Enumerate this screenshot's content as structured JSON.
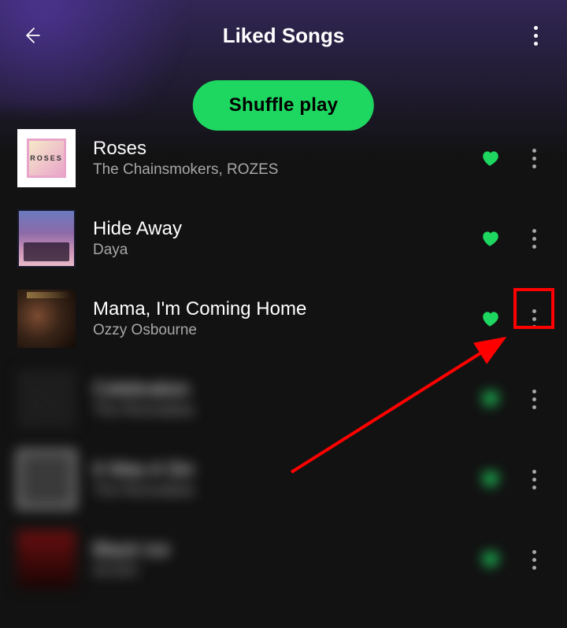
{
  "header": {
    "title": "Liked Songs"
  },
  "shuffle_label": "Shuffle play",
  "songs": [
    {
      "title": "Roses",
      "artist": "The Chainsmokers, ROZES"
    },
    {
      "title": "Hide Away",
      "artist": "Daya"
    },
    {
      "title": "Mama, I'm Coming Home",
      "artist": "Ozzy Osbourne"
    },
    {
      "title": "Celebration",
      "artist": "The Revivalists"
    },
    {
      "title": "It Was A Sin",
      "artist": "The Revivalists"
    },
    {
      "title": "Black Ice",
      "artist": "AC/DC"
    }
  ],
  "annotation": {
    "highlight_color": "#ff0000"
  }
}
